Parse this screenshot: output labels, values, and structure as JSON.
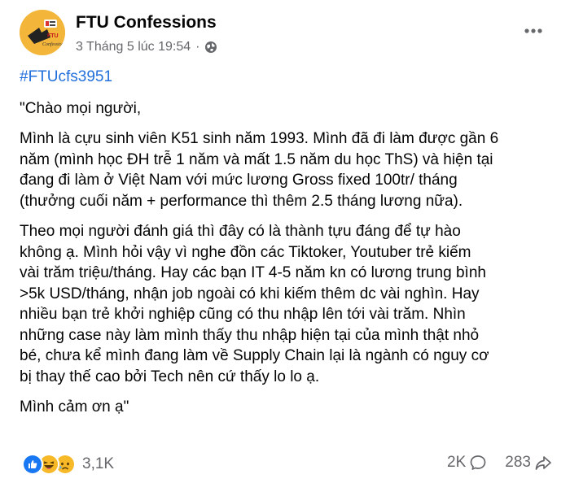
{
  "post": {
    "page_name": "FTU Confessions",
    "timestamp": "3 Tháng 5 lúc 19:54",
    "separator": "·",
    "privacy_icon": "globe-icon",
    "hashtag": "#FTUcfs3951",
    "paragraphs": [
      "\"Chào mọi người,",
      "Mình là cựu sinh viên K51 sinh năm 1993. Mình đã đi làm được gần 6\nnăm (mình học ĐH trễ 1 năm và mất 1.5 năm du học ThS) và hiện tại\nđang đi làm ở Việt Nam với mức lương Gross fixed 100tr/ tháng\n(thưởng cuối năm + performance thì thêm 2.5 tháng lương nữa).",
      "Theo mọi người đánh giá thì đây có là thành tựu đáng để tự hào\nkhông ạ. Mình hỏi vậy vì nghe đồn các Tiktoker, Youtuber trẻ kiếm\nvài trăm triệu/tháng. Hay các bạn IT 4-5 năm kn có lương trung bình\n>5k USD/tháng, nhận job ngoài có khi kiếm thêm dc vài nghìn. Hay\nnhiều bạn trẻ khởi nghiệp cũng có thu nhập lên tới vài trăm. Nhìn\nnhững case này làm mình thấy thu nhập hiện tại của mình thật nhỏ\nbé, chưa kể mình đang làm về Supply Chain lại là ngành có nguy cơ\nbị thay thế cao bởi Tech nên cứ thấy lo lo ạ.",
      "Mình cảm ơn ạ\""
    ],
    "avatar_text": "FTU Confessions"
  },
  "footer": {
    "reaction_icons": [
      "like-icon",
      "haha-icon",
      "sad-icon"
    ],
    "reaction_count": "3,1K",
    "comment_count": "2K",
    "share_count": "283"
  },
  "colors": {
    "hashtag": "#216fdb",
    "meta": "#65676b",
    "like": "#1877f2",
    "emoji": "#f7b928"
  }
}
